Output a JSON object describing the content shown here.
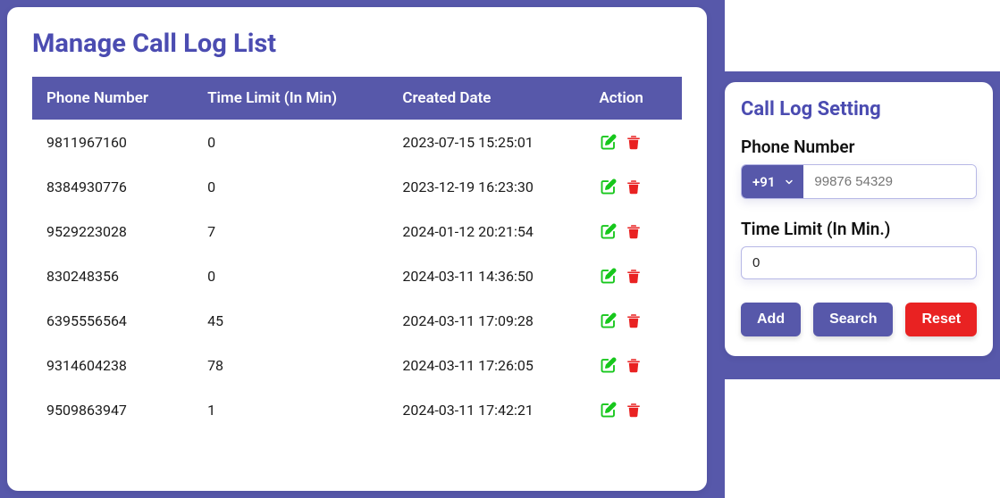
{
  "main": {
    "title": "Manage Call Log List",
    "columns": [
      "Phone Number",
      "Time Limit (In Min)",
      "Created Date",
      "Action"
    ],
    "rows": [
      {
        "phone": "9811967160",
        "limit": "0",
        "created": "2023-07-15 15:25:01"
      },
      {
        "phone": "8384930776",
        "limit": "0",
        "created": "2023-12-19 16:23:30"
      },
      {
        "phone": "9529223028",
        "limit": "7",
        "created": "2024-01-12 20:21:54"
      },
      {
        "phone": "830248356",
        "limit": "0",
        "created": "2024-03-11 14:36:50"
      },
      {
        "phone": "6395556564",
        "limit": "45",
        "created": "2024-03-11 17:09:28"
      },
      {
        "phone": "9314604238",
        "limit": "78",
        "created": "2024-03-11 17:26:05"
      },
      {
        "phone": "9509863947",
        "limit": "1",
        "created": "2024-03-11 17:42:21"
      }
    ]
  },
  "side": {
    "title": "Call Log Setting",
    "phone_label": "Phone Number",
    "country_code": "+91",
    "phone_placeholder": "99876 54329",
    "time_label": "Time Limit (In Min.)",
    "time_value": "0",
    "buttons": {
      "add": "Add",
      "search": "Search",
      "reset": "Reset"
    }
  },
  "colors": {
    "primary": "#5758aa",
    "title": "#4b4cb1",
    "edit": "#17c71c",
    "delete": "#e92222"
  }
}
